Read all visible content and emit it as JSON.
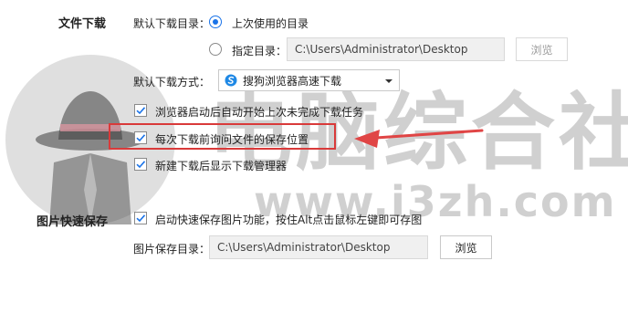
{
  "download": {
    "section_title": "文件下载",
    "default_dir_label": "默认下载目录：",
    "option_last_used": "上次使用的目录",
    "option_specified": "指定目录：",
    "specified_path": "C:\\Users\\Administrator\\Desktop",
    "browse_label": "浏览",
    "method_label": "默认下载方式：",
    "method_value": "搜狗浏览器高速下载",
    "checks": [
      "浏览器启动后自动开始上次未完成下载任务",
      "每次下载前询问文件的保存位置",
      "新建下载后显示下载管理器"
    ]
  },
  "image_save": {
    "section_title": "图片快速保存",
    "check_label": "启动快速保存图片功能，按住Alt点击鼠标左键即可存图",
    "dir_label": "图片保存目录：",
    "path": "C:\\Users\\Administrator\\Desktop",
    "browse_label": "浏览"
  },
  "watermark": {
    "brand": "电脑综合社区",
    "url": "www.i3zh.com"
  },
  "colors": {
    "accent": "#1a73e8",
    "highlight_box": "#d93a3a",
    "arrow": "#e04545"
  },
  "icons": {
    "method_icon": "sogou-browser-icon",
    "dropdown": "caret-down-icon",
    "check": "checkmark-icon"
  }
}
